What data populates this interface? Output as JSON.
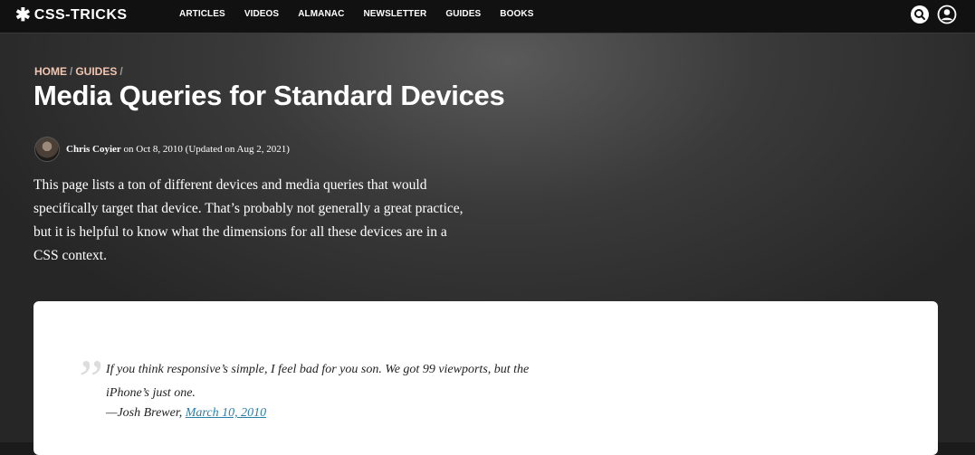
{
  "header": {
    "logo_mark": "✱",
    "logo_text": "CSS-TRICKS",
    "nav": [
      {
        "label": "ARTICLES"
      },
      {
        "label": "VIDEOS"
      },
      {
        "label": "ALMANAC"
      },
      {
        "label": "NEWSLETTER"
      },
      {
        "label": "GUIDES"
      },
      {
        "label": "BOOKS"
      }
    ],
    "icons": [
      "search-icon",
      "user-icon"
    ]
  },
  "breadcrumb": {
    "items": [
      "HOME",
      "GUIDES"
    ],
    "separator": "/"
  },
  "article": {
    "title": "Media Queries for Standard Devices",
    "author": "Chris Coyier",
    "meta": "on Oct 8, 2010 (Updated on Aug 2, 2021)",
    "intro": "This page lists a ton of different devices and media queries that would specifically target that device. That’s probably not generally a great practice, but it is helpful to know what the dimensions for all these devices are in a CSS context."
  },
  "quote": {
    "mark": "”",
    "text": "If you think responsive’s simple, I feel bad for you son. We got 99 viewports, but the iPhone’s just one.",
    "attribution": "—Josh Brewer,",
    "date_link": "March 10, 2010"
  },
  "colors": {
    "breadcrumb_link": "#f2c6b0",
    "link": "#2a7fa8",
    "topbar": "#111111"
  }
}
